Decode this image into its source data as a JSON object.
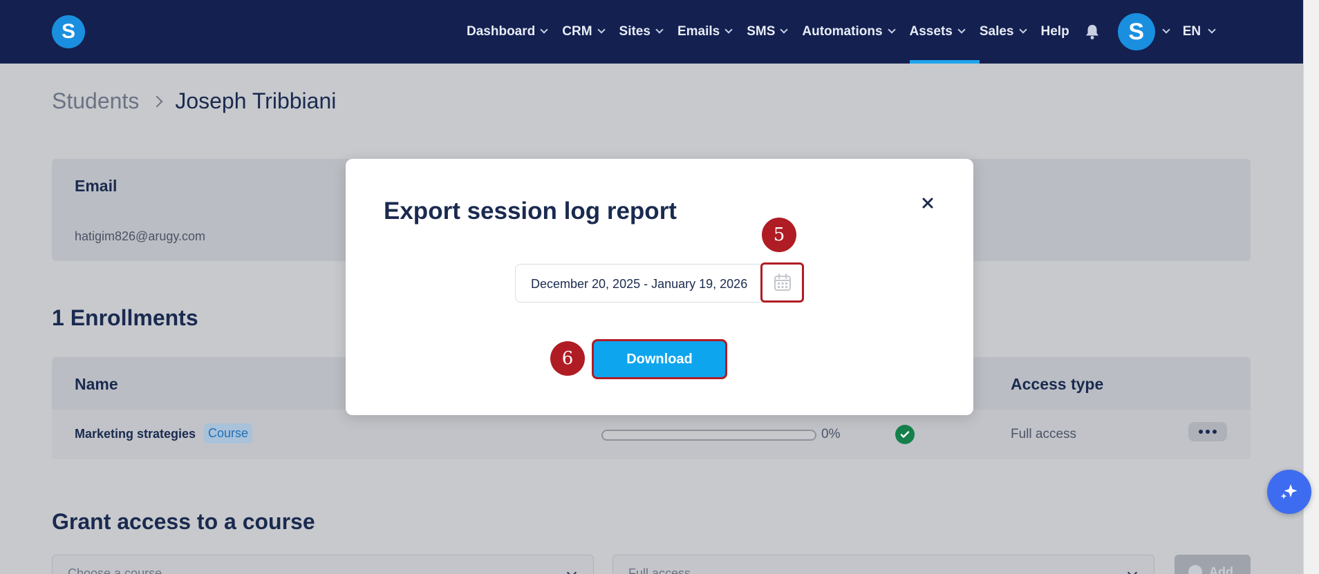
{
  "nav": {
    "logo_letter": "S",
    "items": [
      {
        "label": "Dashboard",
        "has_chevron": true
      },
      {
        "label": "CRM",
        "has_chevron": true
      },
      {
        "label": "Sites",
        "has_chevron": true
      },
      {
        "label": "Emails",
        "has_chevron": true
      },
      {
        "label": "SMS",
        "has_chevron": true
      },
      {
        "label": "Automations",
        "has_chevron": true
      },
      {
        "label": "Assets",
        "has_chevron": true,
        "active": true
      },
      {
        "label": "Sales",
        "has_chevron": true
      },
      {
        "label": "Help",
        "has_chevron": false
      }
    ],
    "bell_icon": "bell-icon",
    "avatar_letter": "S",
    "language": "EN"
  },
  "breadcrumb": {
    "parent": "Students",
    "current": "Joseph Tribbiani"
  },
  "email_card": {
    "label": "Email",
    "value": "hatigim826@arugy.com"
  },
  "enrollments": {
    "title": "1 Enrollments",
    "headers": {
      "name": "Name",
      "access_type": "Access type"
    },
    "rows": [
      {
        "name": "Marketing strategies",
        "badge": "Course",
        "progress_percent": 0,
        "progress_text": "0%",
        "status_icon": "check-circle-icon",
        "access": "Full access"
      }
    ]
  },
  "grant_access": {
    "title": "Grant access to a course",
    "course_placeholder": "Choose a course",
    "access_value": "Full access",
    "add_label": "Add"
  },
  "modal": {
    "title": "Export session log report",
    "date_range": "December 20, 2025 - January 19, 2026",
    "download_label": "Download",
    "close_icon": "close-icon",
    "step_markers": [
      "5",
      "6"
    ]
  },
  "colors": {
    "nav_bg": "#132050",
    "accent": "#0ea5ef",
    "highlight": "#b01c24",
    "success": "#15804c"
  }
}
